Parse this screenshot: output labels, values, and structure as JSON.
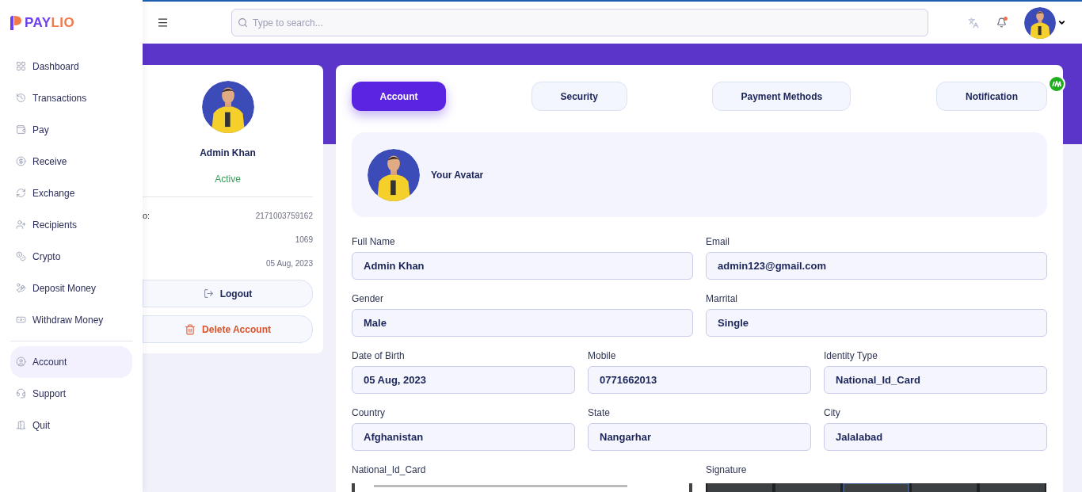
{
  "brand": {
    "first": "PAY",
    "second": "LIO"
  },
  "sidebar": {
    "main_items": [
      {
        "label": "Dashboard",
        "selected": false
      },
      {
        "label": "Transactions",
        "selected": false
      },
      {
        "label": "Pay",
        "selected": false
      },
      {
        "label": "Receive",
        "selected": false
      },
      {
        "label": "Exchange",
        "selected": false
      },
      {
        "label": "Recipients",
        "selected": false
      },
      {
        "label": "Crypto",
        "selected": false
      },
      {
        "label": "Deposit Money",
        "selected": false
      },
      {
        "label": "Withdraw Money",
        "selected": false
      }
    ],
    "bottom_items": [
      {
        "label": "Account",
        "selected": true
      },
      {
        "label": "Support",
        "selected": false
      },
      {
        "label": "Quit",
        "selected": false
      }
    ]
  },
  "header": {
    "search": {
      "placeholder": "Type to search..."
    },
    "notification_dot": true
  },
  "profile_card": {
    "name": "Admin Khan",
    "status": "Active",
    "rows": [
      {
        "label": "o:",
        "value": "2171003759162"
      },
      {
        "value": "1069"
      },
      {
        "value": "05 Aug, 2023"
      }
    ],
    "logout": "Logout",
    "delete": "Delete Account"
  },
  "tabs": [
    {
      "label": "Account",
      "selected": true
    },
    {
      "label": "Security",
      "selected": false
    },
    {
      "label": "Payment Methods",
      "selected": false
    },
    {
      "label": "Notification",
      "selected": false
    }
  ],
  "avatar_label": "Your Avatar",
  "fields_row1": [
    {
      "label": "Full Name",
      "value": "Admin Khan"
    },
    {
      "label": "Email",
      "value": "admin123@gmail.com"
    },
    {
      "label": "Gender",
      "value": "Male"
    },
    {
      "label": "Marrital",
      "value": "Single"
    }
  ],
  "fields_row2": [
    {
      "label": "Date of Birth",
      "value": "05 Aug, 2023"
    },
    {
      "label": "Mobile",
      "value": "0771662013"
    },
    {
      "label": "Identity Type",
      "value": "National_Id_Card"
    },
    {
      "label": "Country",
      "value": "Afghanistan"
    },
    {
      "label": "State",
      "value": "Nangarhar"
    },
    {
      "label": "City",
      "value": "Jalalabad"
    }
  ],
  "documents": [
    {
      "label": "National_Id_Card",
      "kind": "picture"
    },
    {
      "label": "Signature",
      "kind": "picture"
    }
  ]
}
